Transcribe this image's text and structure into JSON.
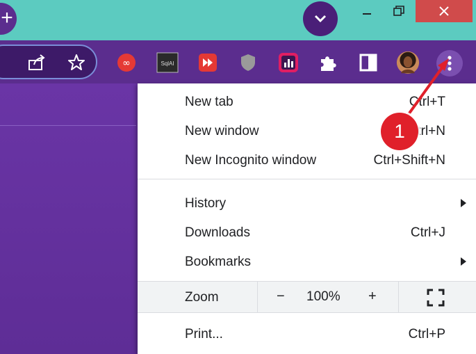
{
  "colors": {
    "titlebar": "#5ccbc0",
    "toolbar": "#5b2d8e",
    "menu_bg": "#ffffff",
    "annotation_red": "#e0202a"
  },
  "titlebar": {
    "newtab_icon": "plus-icon",
    "tabsearch_icon": "chevron-down-icon",
    "minimize_icon": "minimize-icon",
    "restore_icon": "restore-icon",
    "close_icon": "close-icon"
  },
  "toolbar": {
    "icons": [
      "share-icon",
      "star-icon",
      "infinity-extension-icon",
      "sqlai-extension-icon",
      "fast-forward-extension-icon",
      "shield-extension-icon",
      "chart-extension-icon",
      "puzzle-icon",
      "side-panel-icon",
      "avatar",
      "kebab-menu-icon"
    ],
    "ext_label_sqlai": "SqlAI"
  },
  "menu": {
    "items": [
      {
        "label": "New tab",
        "shortcut": "Ctrl+T"
      },
      {
        "label": "New window",
        "shortcut": "Ctrl+N"
      },
      {
        "label": "New Incognito window",
        "shortcut": "Ctrl+Shift+N"
      },
      {
        "label": "History",
        "shortcut": ""
      },
      {
        "label": "Downloads",
        "shortcut": "Ctrl+J"
      },
      {
        "label": "Bookmarks",
        "shortcut": ""
      }
    ],
    "zoom": {
      "label": "Zoom",
      "minus": "−",
      "value": "100%",
      "plus": "+",
      "fullscreen_icon": "fullscreen-icon"
    },
    "print": {
      "label": "Print...",
      "shortcut": "Ctrl+P"
    }
  },
  "annotation": {
    "badge_text": "1"
  }
}
